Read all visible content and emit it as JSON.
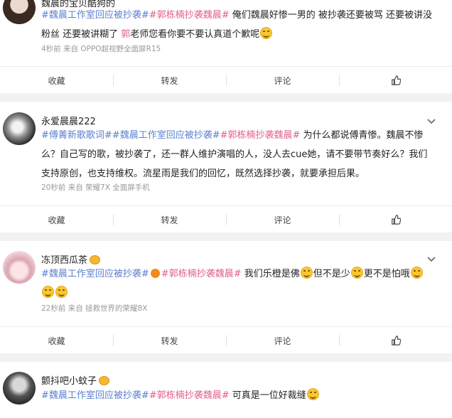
{
  "actions": {
    "favorite": "收藏",
    "repost": "转发",
    "comment": "评论"
  },
  "posts": [
    {
      "username": "魏晨的宝贝酷狗的",
      "segments": [
        {
          "t": "#魏晨工作室回应被抄袭#",
          "c": "tag"
        },
        {
          "t": "#郭栋楠抄袭魏晨#",
          "c": "tag-pink"
        },
        {
          "t": " 俺们魏晨好惨一男的 被抄袭还要被骂 还要被讲没粉丝 还要被讲糊了 ",
          "c": ""
        },
        {
          "t": "郭",
          "c": "tag-pink"
        },
        {
          "t": "老师您看你要不要认真道个歉呢",
          "c": ""
        }
      ],
      "meta": "4秒前 来自 OPPO超视野全面屏R15"
    },
    {
      "username": "永爱晨晨222",
      "segments": [
        {
          "t": "#傅菁新歌歌词#",
          "c": "tag"
        },
        {
          "t": "#魏晨工作室回应被抄袭#",
          "c": "tag"
        },
        {
          "t": "#郭栋楠抄袭魏晨#",
          "c": "tag-pink"
        },
        {
          "t": " 为什么都说傅青惨。魏晨不惨么？自己写的歌，被抄袭了，还一群人维护演唱的人，没人去cue她，请不要带节奏好么？我们支持原创，也支持维权。流星雨是我们的回忆，既然选择抄袭，就要承担后果。",
          "c": ""
        }
      ],
      "meta": "20秒前 来自 荣耀7X 全面屏手机"
    },
    {
      "username": "冻顶西瓜茶",
      "segments": [
        {
          "t": "#魏晨工作室回应被抄袭#",
          "c": "tag"
        },
        {
          "t": "#郭栋楠抄袭魏晨#",
          "c": "tag-pink"
        },
        {
          "t": " 我们乐橙是佛",
          "c": ""
        },
        {
          "t": "但不是少",
          "c": ""
        },
        {
          "t": "更不是怕哦",
          "c": ""
        }
      ],
      "meta": "22秒前 来自 拯救世界的荣耀8X"
    },
    {
      "username": "颤抖吧小蚊子",
      "segments": [
        {
          "t": "#魏晨工作室回应被抄袭#",
          "c": "tag"
        },
        {
          "t": "#郭栋楠抄袭魏晨#",
          "c": "tag-pink"
        },
        {
          "t": " 可真是一位好裁缝",
          "c": ""
        }
      ],
      "meta": ""
    }
  ]
}
